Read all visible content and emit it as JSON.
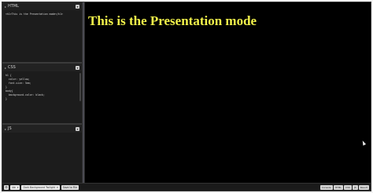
{
  "panels": {
    "html": {
      "title": "HTML",
      "code": [
        "<h1>This is the Presentation mode</h1>"
      ]
    },
    "css": {
      "title": "CSS",
      "code": [
        "h1 {",
        "  color: yellow;",
        "  font-size: 5em;",
        "}",
        "",
        "body{",
        "  background-color: black;",
        "}"
      ]
    },
    "js": {
      "title": "JS",
      "code": []
    }
  },
  "preview": {
    "heading": "This is the Presentation mode"
  },
  "statusbar": {
    "gear_icon": "gear-icon",
    "layout_select": "ide",
    "theme_select": "Dark Background Twilight",
    "save_button": "Save to File",
    "tabs": [
      "Console",
      "HTML",
      "CSS",
      "JS",
      "Result"
    ]
  },
  "colors": {
    "heading": "#f2f24a",
    "preview_background": "#000000",
    "editor_background": "#1c1c1c"
  }
}
